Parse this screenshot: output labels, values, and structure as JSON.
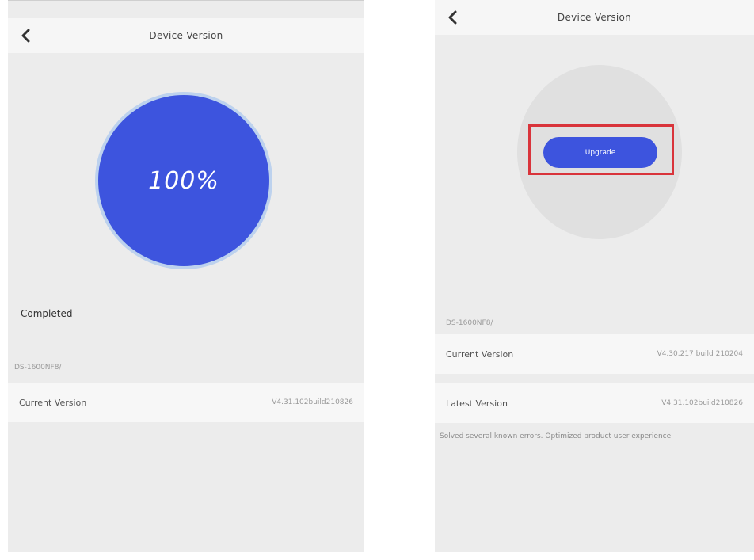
{
  "left": {
    "title": "Device Version",
    "progress_text": "100%",
    "progress": 1.0,
    "status": "Completed",
    "device_id": "DS-1600NF8/",
    "current_version_label": "Current Version",
    "current_version_value": "V4.31.102build210826"
  },
  "right": {
    "title": "Device Version",
    "upgrade_label": "Upgrade",
    "device_id": "DS-1600NF8/",
    "current_version_label": "Current Version",
    "current_version_value": "V4.30.217 build 210204",
    "latest_version_label": "Latest Version",
    "latest_version_value": "V4.31.102build210826",
    "release_notes": "Solved several known errors. Optimized product user experience."
  },
  "colors": {
    "accent": "#3d54de",
    "highlight": "#d9343b",
    "background": "#ececec"
  }
}
